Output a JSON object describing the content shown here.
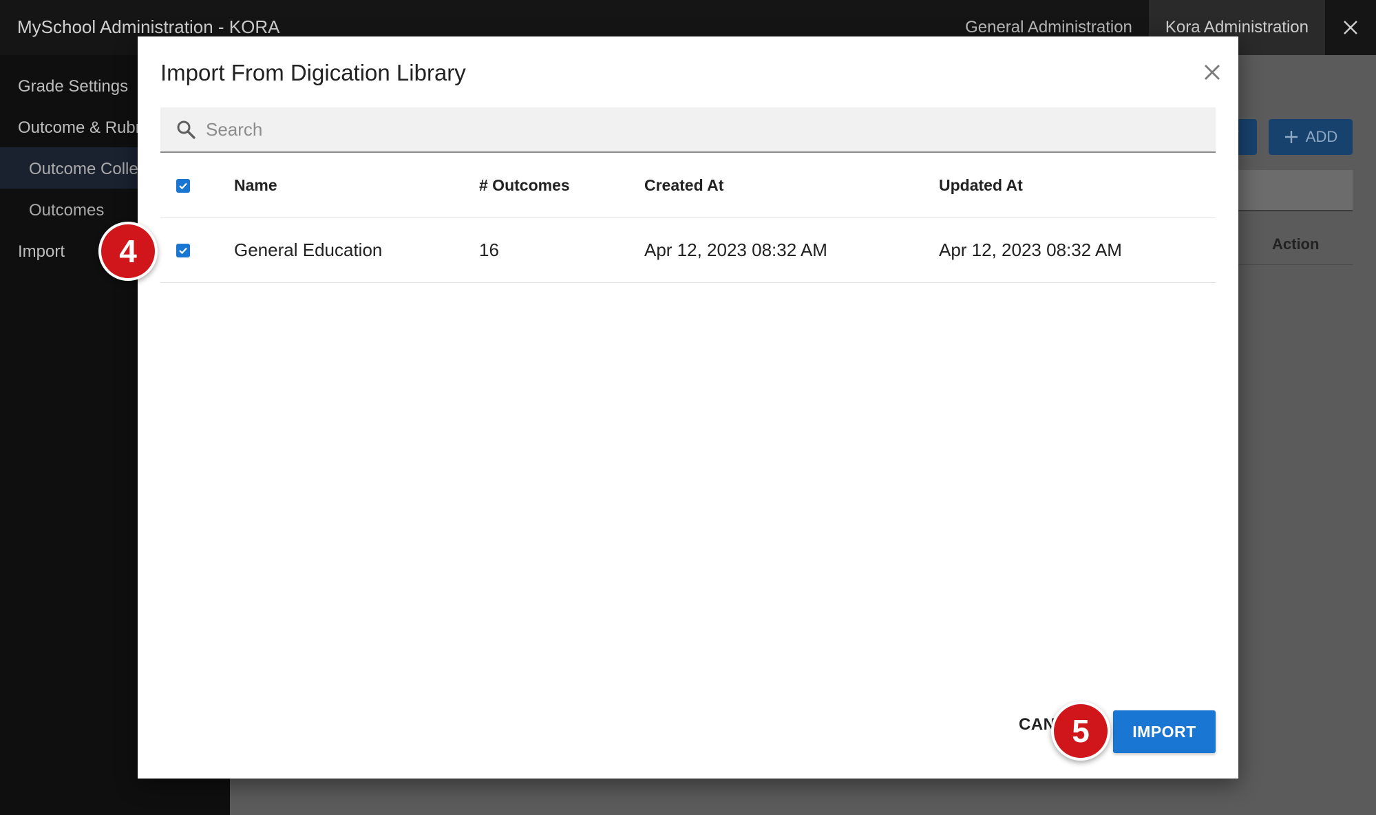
{
  "app": {
    "title": "MySchool Administration - KORA",
    "nav": [
      "General Administration",
      "Kora Administration"
    ]
  },
  "sidebar": {
    "items": [
      {
        "label": "Grade Settings"
      },
      {
        "label": "Outcome & Rubr"
      },
      {
        "label": "Outcome Colle"
      },
      {
        "label": "Outcomes"
      },
      {
        "label": "Import"
      }
    ]
  },
  "background": {
    "partial_button_label": "Y",
    "add_button_label": "ADD",
    "action_column_label": "Action"
  },
  "modal": {
    "title": "Import From Digication Library",
    "search": {
      "placeholder": "Search",
      "value": ""
    },
    "table": {
      "columns": [
        "Name",
        "# Outcomes",
        "Created At",
        "Updated At"
      ],
      "select_all_checked": true,
      "rows": [
        {
          "checked": true,
          "name": "General Education",
          "outcomes": "16",
          "created_at": "Apr 12, 2023 08:32 AM",
          "updated_at": "Apr 12, 2023 08:32 AM"
        }
      ]
    },
    "cancel_label": "CAN",
    "import_label": "IMPORT"
  },
  "callouts": {
    "step_a": "4",
    "step_b": "5"
  },
  "colors": {
    "primary": "#1976d2",
    "callout": "#d0161b"
  }
}
